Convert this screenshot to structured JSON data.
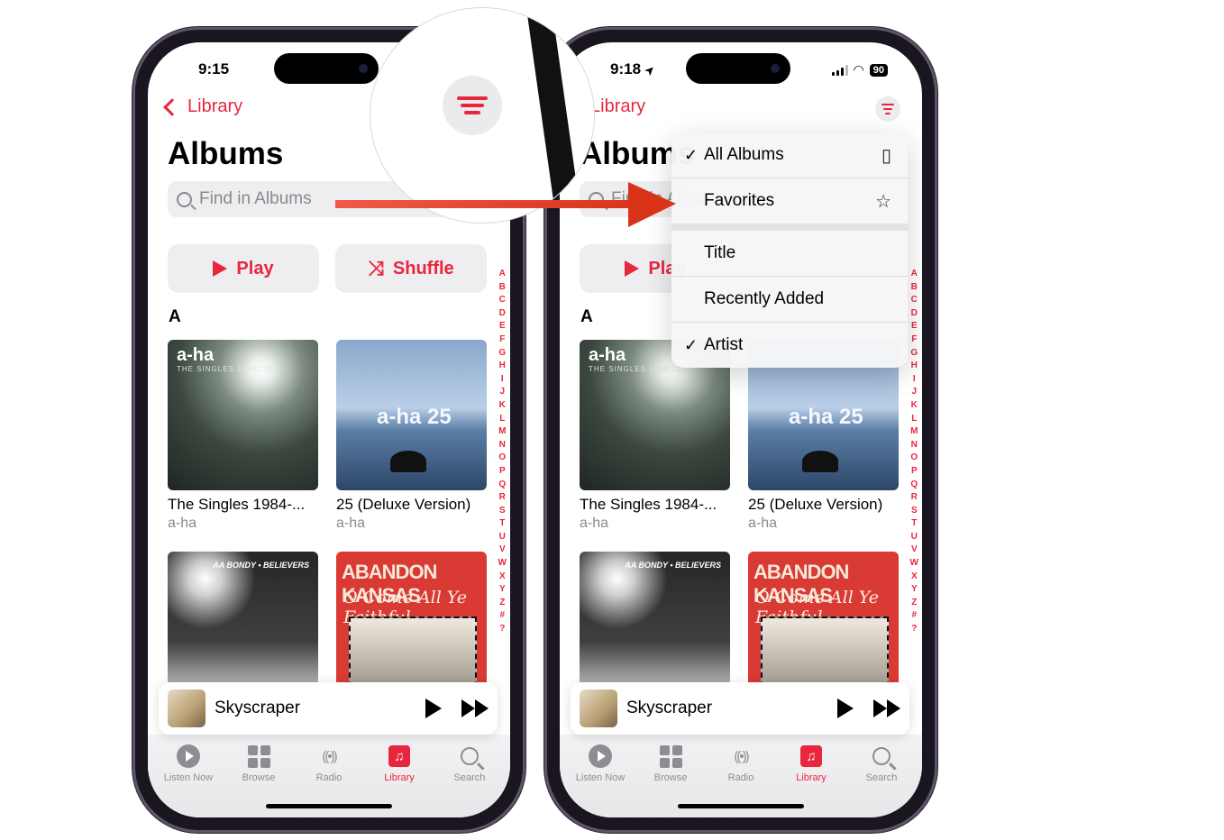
{
  "left_phone": {
    "status_time": "9:15",
    "back_label": "Library",
    "title": "Albums",
    "search_placeholder": "Find in Albums",
    "play_label": "Play",
    "shuffle_label": "Shuffle",
    "section_header": "A",
    "index_letters": [
      "A",
      "B",
      "C",
      "D",
      "E",
      "F",
      "G",
      "H",
      "I",
      "J",
      "K",
      "L",
      "M",
      "N",
      "O",
      "P",
      "Q",
      "R",
      "S",
      "T",
      "U",
      "V",
      "W",
      "X",
      "Y",
      "Z",
      "#",
      "?"
    ],
    "albums": [
      {
        "name": "The Singles 1984-...",
        "artist": "a-ha",
        "art_text": "a-ha",
        "art_sub": "THE SINGLES 1984|2004"
      },
      {
        "name": "25 (Deluxe Version)",
        "artist": "a-ha",
        "art_text": "a-ha 25"
      },
      {
        "art_text": "AA BONDY • BELIEVERS"
      },
      {
        "art_text": "ABANDON KANSAS",
        "art_sub": "O Come All Ye Faithful"
      }
    ],
    "mini_player": {
      "song": "Skyscraper"
    },
    "tabs": [
      {
        "label": "Listen Now",
        "icon": "play-circle-icon"
      },
      {
        "label": "Browse",
        "icon": "grid-icon"
      },
      {
        "label": "Radio",
        "icon": "radio-waves-icon"
      },
      {
        "label": "Library",
        "icon": "music-library-icon",
        "active": true
      },
      {
        "label": "Search",
        "icon": "search-icon"
      }
    ]
  },
  "right_phone": {
    "status_time": "9:18",
    "battery": "90",
    "back_label": "Library",
    "title": "Albums",
    "search_placeholder": "Find in Albums",
    "play_label": "Play",
    "section_header": "A",
    "sort_menu": {
      "filter_items": [
        {
          "label": "All Albums",
          "checked": true,
          "icon": "album-stack-icon"
        },
        {
          "label": "Favorites",
          "checked": false,
          "icon": "star-icon"
        }
      ],
      "sort_items": [
        {
          "label": "Title",
          "checked": false
        },
        {
          "label": "Recently Added",
          "checked": false
        },
        {
          "label": "Artist",
          "checked": true
        }
      ]
    },
    "albums": [
      {
        "name": "The Singles 1984-...",
        "artist": "a-ha",
        "art_text": "a-ha",
        "art_sub": "THE SINGLES 1984|2004"
      },
      {
        "name": "25 (Deluxe Version)",
        "artist": "a-ha",
        "art_text": "a-ha 25"
      },
      {
        "art_text": "AA BONDY • BELIEVERS"
      },
      {
        "art_text": "ABANDON KANSAS",
        "art_sub": "O Come All Ye Faithful"
      }
    ],
    "mini_player": {
      "song": "Skyscraper"
    },
    "tabs": [
      {
        "label": "Listen Now"
      },
      {
        "label": "Browse"
      },
      {
        "label": "Radio"
      },
      {
        "label": "Library",
        "active": true
      },
      {
        "label": "Search"
      }
    ]
  },
  "annotation": {
    "accent": "#e8263e",
    "arrow_color": "#e03a22"
  },
  "glyphs": {
    "check": "✓",
    "star": "☆",
    "shuffle": "⤨",
    "music": "♫",
    "radio": "((•))",
    "stack": "▯",
    "location": "➤"
  }
}
